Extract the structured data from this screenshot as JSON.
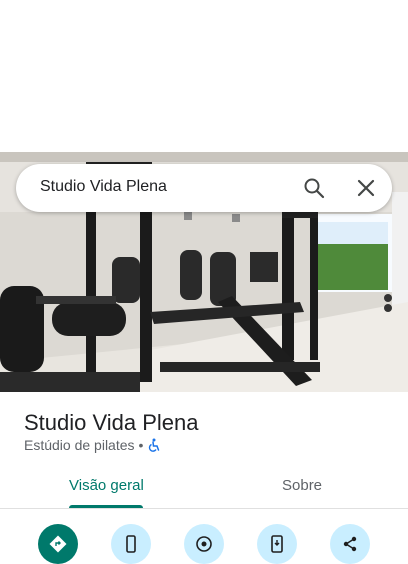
{
  "search": {
    "query": "Studio Vida Plena"
  },
  "place": {
    "name": "Studio Vida Plena",
    "category": "Estúdio de pilates",
    "separator": "•"
  },
  "tabs": [
    {
      "label": "Visão geral",
      "selected": true
    },
    {
      "label": "Sobre",
      "selected": false
    }
  ],
  "actions": [
    {
      "icon": "directions-icon"
    },
    {
      "icon": "phone-icon"
    },
    {
      "icon": "location-pin-icon"
    },
    {
      "icon": "add-to-phone-icon"
    },
    {
      "icon": "share-icon"
    }
  ],
  "colors": {
    "accent": "#00796b",
    "action_bg": "#c9eeff",
    "text_primary": "#202124",
    "text_secondary": "#5f6368",
    "accessibility_blue": "#1a73e8"
  }
}
